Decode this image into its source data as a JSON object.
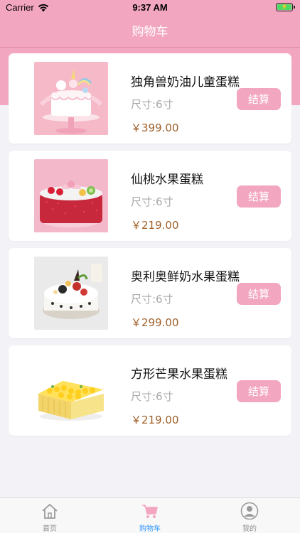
{
  "status_bar": {
    "carrier": "Carrier",
    "time": "9:37 AM"
  },
  "nav": {
    "title": "购物车"
  },
  "cart_items": [
    {
      "name": "独角兽奶油儿童蛋糕",
      "size": "尺寸:6寸",
      "price": "￥399.00",
      "action": "结算"
    },
    {
      "name": "仙桃水果蛋糕",
      "size": "尺寸:6寸",
      "price": "￥219.00",
      "action": "结算"
    },
    {
      "name": "奥利奥鲜奶水果蛋糕",
      "size": "尺寸:6寸",
      "price": "￥299.00",
      "action": "结算"
    },
    {
      "name": "方形芒果水果蛋糕",
      "size": "尺寸:6寸",
      "price": "￥219.00",
      "action": "结算"
    }
  ],
  "tabbar": {
    "items": [
      {
        "label": "首页",
        "icon": "home-icon"
      },
      {
        "label": "购物车",
        "icon": "cart-icon",
        "active": true
      },
      {
        "label": "我的",
        "icon": "profile-icon"
      }
    ]
  },
  "colors": {
    "accent": "#f3a6c0",
    "price": "#a0602a",
    "tab_active": "#2f96ff"
  }
}
